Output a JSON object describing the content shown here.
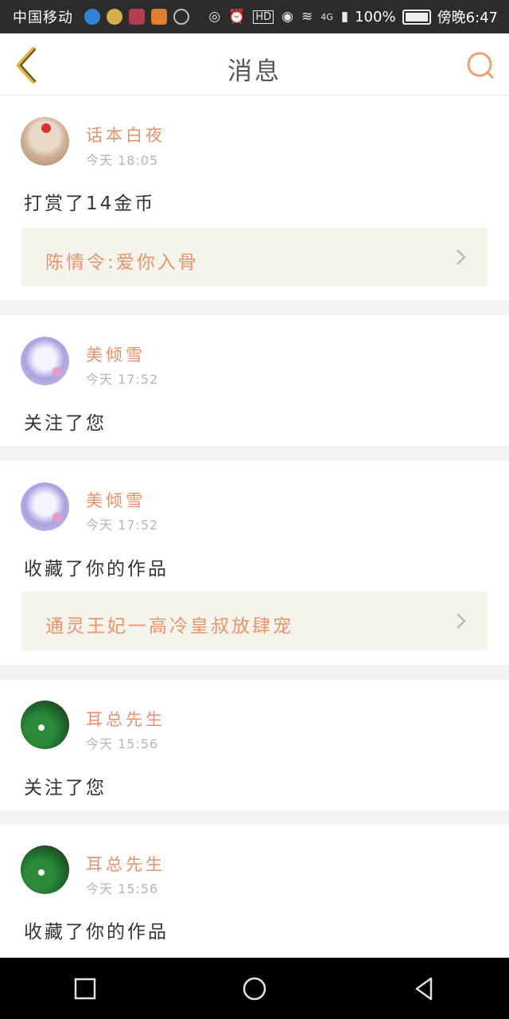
{
  "status_bar": {
    "carrier": "中国移动",
    "battery": "100%",
    "time": "傍晚6:47",
    "network": "4G",
    "hd": "HD"
  },
  "header": {
    "title": "消息"
  },
  "theme": {
    "accent": "#e7906a",
    "link_bg": "#f4f3ec",
    "back_color": "#e0b33a"
  },
  "messages": [
    {
      "username": "话本白夜",
      "time": "今天 18:05",
      "action": "打赏了14金币",
      "link": "陈情令:爱你入骨"
    },
    {
      "username": "美倾雪",
      "time": "今天 17:52",
      "action": "关注了您"
    },
    {
      "username": "美倾雪",
      "time": "今天 17:52",
      "action": "收藏了你的作品",
      "link": "通灵王妃一高冷皇叔放肆宠"
    },
    {
      "username": "耳总先生",
      "time": "今天 15:56",
      "action": "关注了您"
    },
    {
      "username": "耳总先生",
      "time": "今天 15:56",
      "action": "收藏了你的作品"
    }
  ]
}
